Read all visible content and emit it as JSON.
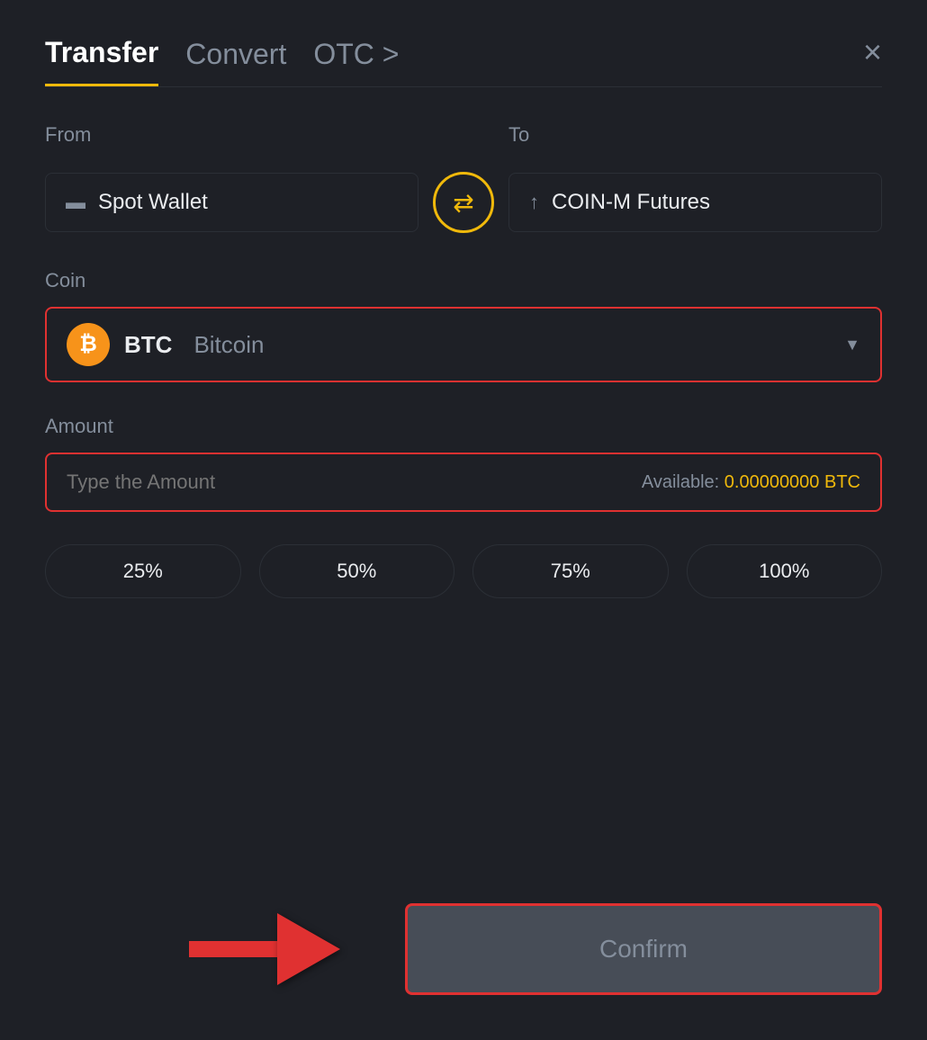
{
  "header": {
    "title": "Transfer",
    "tabs": [
      {
        "label": "Transfer",
        "active": true
      },
      {
        "label": "Convert",
        "active": false
      },
      {
        "label": "OTC >",
        "active": false
      }
    ],
    "close_label": "×"
  },
  "from": {
    "label": "From",
    "wallet_icon": "▬",
    "wallet_name": "Spot Wallet"
  },
  "to": {
    "label": "To",
    "wallet_icon": "↑",
    "wallet_name": "COIN-M Futures"
  },
  "swap_icon": "⇄",
  "coin": {
    "label": "Coin",
    "symbol": "BTC",
    "name": "Bitcoin",
    "icon_letter": "₿"
  },
  "amount": {
    "label": "Amount",
    "placeholder": "Type the Amount",
    "available_label": "Available:",
    "available_value": "0.00000000 BTC"
  },
  "percent_buttons": [
    {
      "label": "25%"
    },
    {
      "label": "50%"
    },
    {
      "label": "75%"
    },
    {
      "label": "100%"
    }
  ],
  "confirm_button": {
    "label": "Confirm"
  },
  "colors": {
    "accent": "#f0b90b",
    "error_border": "#e03131",
    "text_primary": "#eaecef",
    "text_secondary": "#848e9c",
    "bg": "#1e2026"
  }
}
